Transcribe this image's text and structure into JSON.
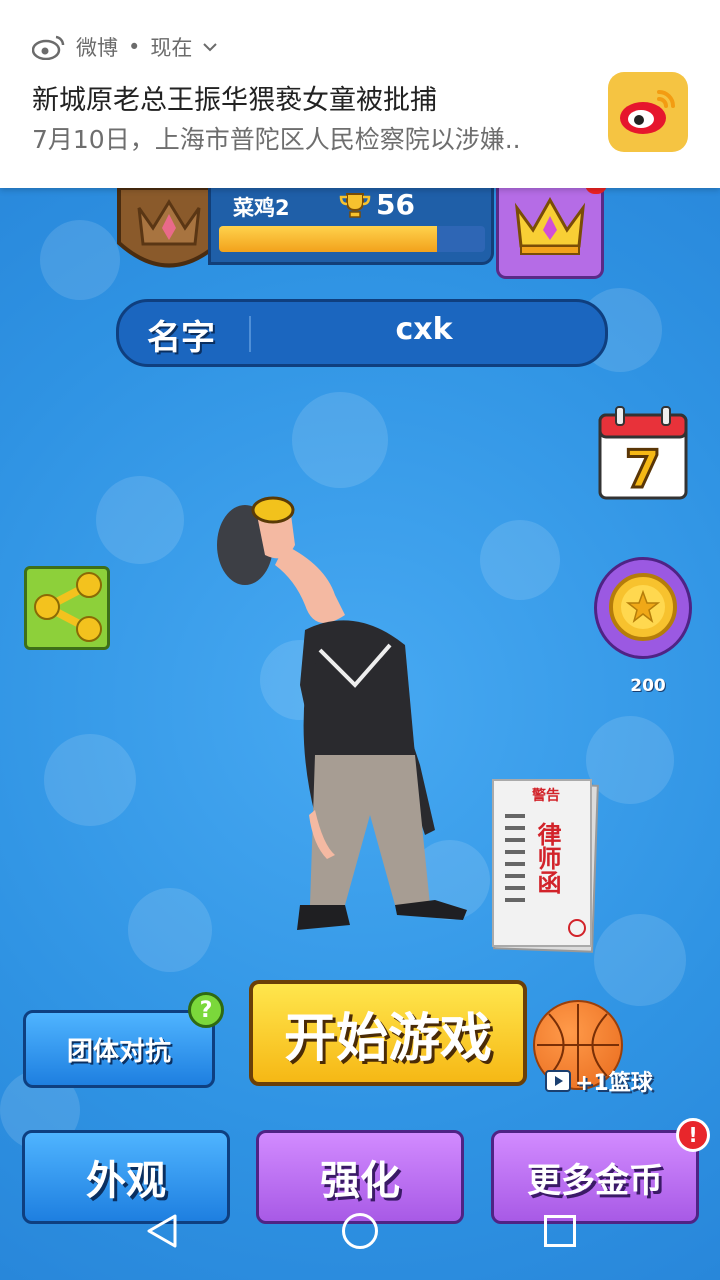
{
  "notification": {
    "app_name": "微博",
    "time": "现在",
    "title": "新城原老总王振华猥亵女童被批捕",
    "body": "7月10日，上海市普陀区人民检察院以涉嫌.."
  },
  "profile": {
    "rank_name": "菜鸡2",
    "trophy_count": "56",
    "xp_progress_percent": 82
  },
  "name_field": {
    "label": "名字",
    "value": "cxk"
  },
  "right_panel": {
    "calendar_day": "7",
    "coin_reward": "200"
  },
  "props": {
    "letter_top": "警告",
    "letter_main": "律师函"
  },
  "buttons": {
    "team_battle": "团体对抗",
    "start_game": "开始游戏",
    "basketball_reward": "+1篮球",
    "appearance": "外观",
    "upgrade": "强化",
    "more_coins": "更多金币"
  },
  "badges": {
    "help": "?",
    "alert": "!"
  },
  "colors": {
    "background": "#2d8fe0",
    "start_button": "#f6b815",
    "purple_button": "#a85ae6",
    "blue_button": "#1e7fe0",
    "weibo_logo_bg": "#f5c442"
  }
}
